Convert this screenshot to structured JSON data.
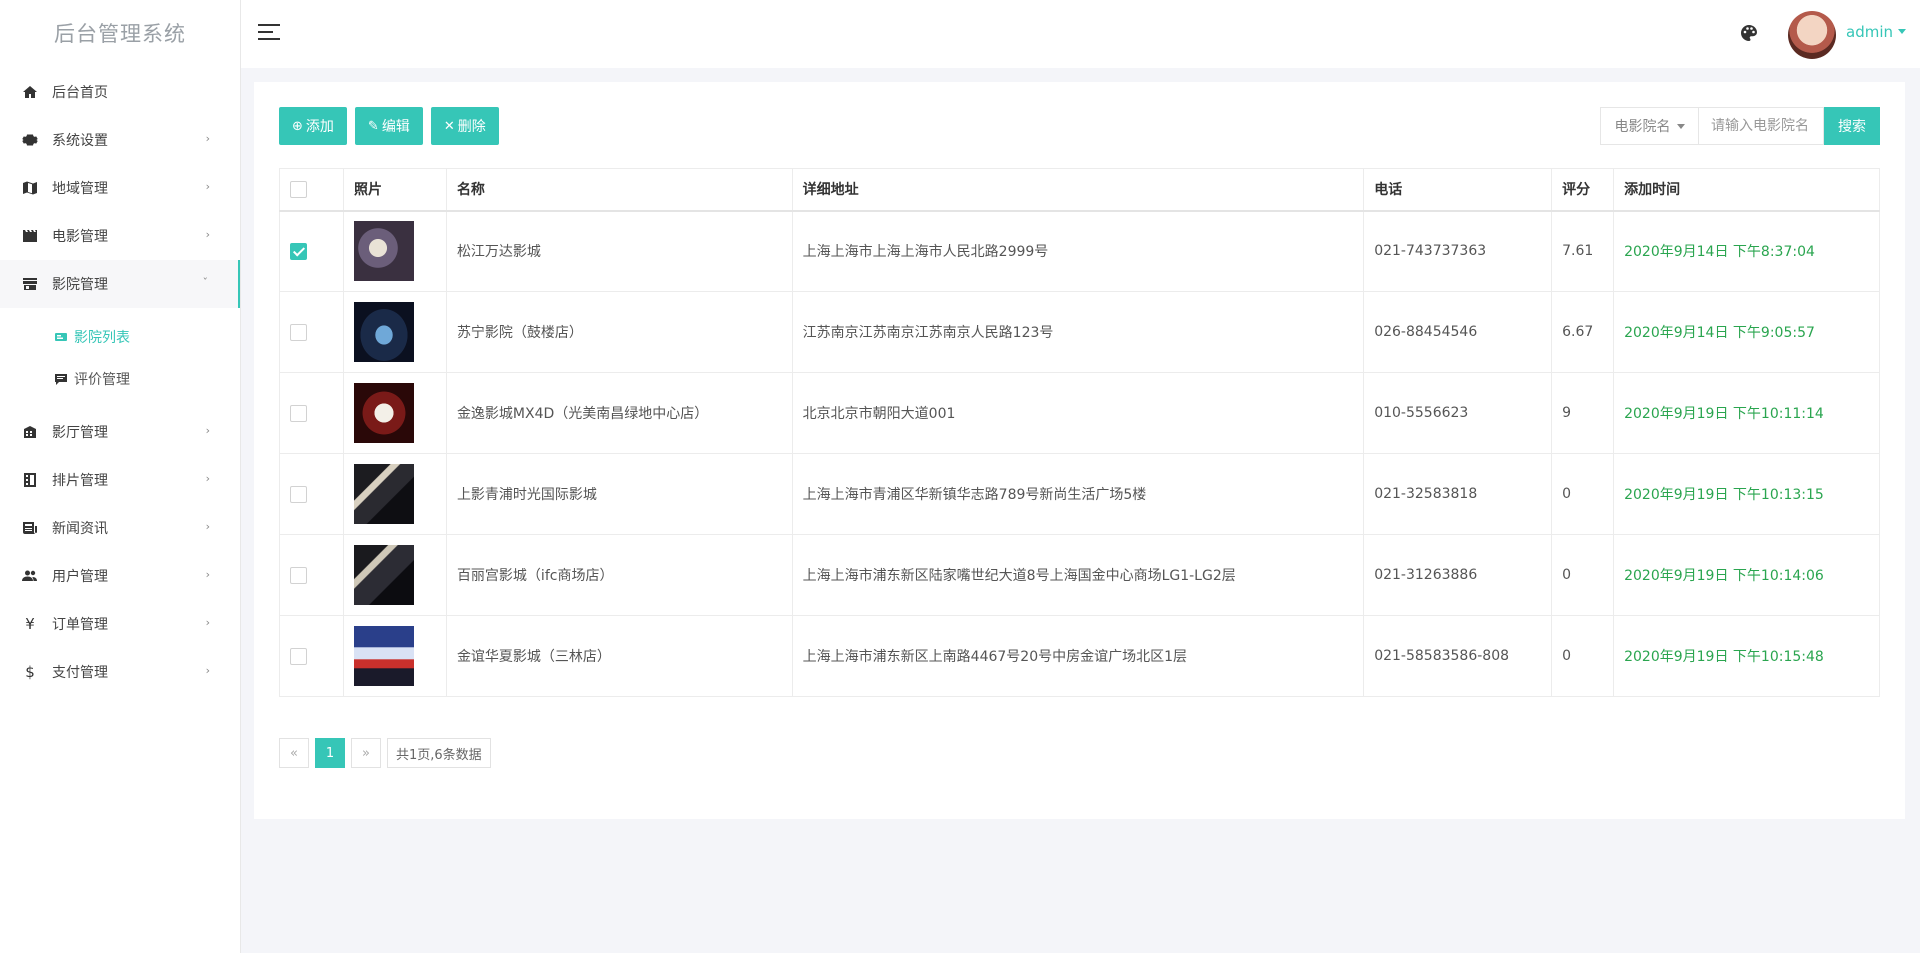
{
  "app": {
    "title": "后台管理系统",
    "user": "admin"
  },
  "sidebar": {
    "items": [
      {
        "label": "后台首页",
        "icon": "home-icon"
      },
      {
        "label": "系统设置",
        "icon": "gear-icon"
      },
      {
        "label": "地域管理",
        "icon": "map-icon"
      },
      {
        "label": "电影管理",
        "icon": "film-icon"
      },
      {
        "label": "影院管理",
        "icon": "store-icon"
      },
      {
        "label": "影厅管理",
        "icon": "building-icon"
      },
      {
        "label": "排片管理",
        "icon": "schedule-icon"
      },
      {
        "label": "新闻资讯",
        "icon": "news-icon"
      },
      {
        "label": "用户管理",
        "icon": "users-icon"
      },
      {
        "label": "订单管理",
        "icon": "yen-icon"
      },
      {
        "label": "支付管理",
        "icon": "dollar-icon"
      }
    ],
    "sub_items": [
      {
        "label": "影院列表",
        "icon": "card-icon"
      },
      {
        "label": "评价管理",
        "icon": "comment-icon"
      }
    ]
  },
  "toolbar": {
    "add": "添加",
    "edit": "编辑",
    "delete": "删除"
  },
  "search": {
    "field": "电影院名",
    "placeholder": "请输入电影院名",
    "button": "搜索"
  },
  "table": {
    "headers": {
      "photo": "照片",
      "name": "名称",
      "address": "详细地址",
      "phone": "电话",
      "score": "评分",
      "time": "添加时间"
    },
    "rows": [
      {
        "name": "松江万达影城",
        "address": "上海上海市上海上海市人民北路2999号",
        "phone": "021-743737363",
        "score": "7.61",
        "time": "2020年9月14日 下午8:37:04",
        "checked": true
      },
      {
        "name": "苏宁影院（鼓楼店）",
        "address": "江苏南京江苏南京江苏南京人民路123号",
        "phone": "026-88454546",
        "score": "6.67",
        "time": "2020年9月14日 下午9:05:57",
        "checked": false
      },
      {
        "name": "金逸影城MX4D（光美南昌绿地中心店）",
        "address": "北京北京市朝阳大道001",
        "phone": "010-5556623",
        "score": "9",
        "time": "2020年9月19日 下午10:11:14",
        "checked": false
      },
      {
        "name": "上影青浦时光国际影城",
        "address": "上海上海市青浦区华新镇华志路789号新尚生活广场5楼",
        "phone": "021-32583818",
        "score": "0",
        "time": "2020年9月19日 下午10:13:15",
        "checked": false
      },
      {
        "name": "百丽宫影城（ifc商场店）",
        "address": "上海上海市浦东新区陆家嘴世纪大道8号上海国金中心商场LG1-LG2层",
        "phone": "021-31263886",
        "score": "0",
        "time": "2020年9月19日 下午10:14:06",
        "checked": false
      },
      {
        "name": "金谊华夏影城（三林店）",
        "address": "上海上海市浦东新区上南路4467号20号中房金谊广场北区1层",
        "phone": "021-58583586-808",
        "score": "0",
        "time": "2020年9月19日 下午10:15:48",
        "checked": false
      }
    ]
  },
  "pager": {
    "prev": "«",
    "current": "1",
    "next": "»",
    "info": "共1页,6条数据"
  },
  "colors": {
    "accent": "#36c6b7",
    "time": "#2aa54f"
  }
}
